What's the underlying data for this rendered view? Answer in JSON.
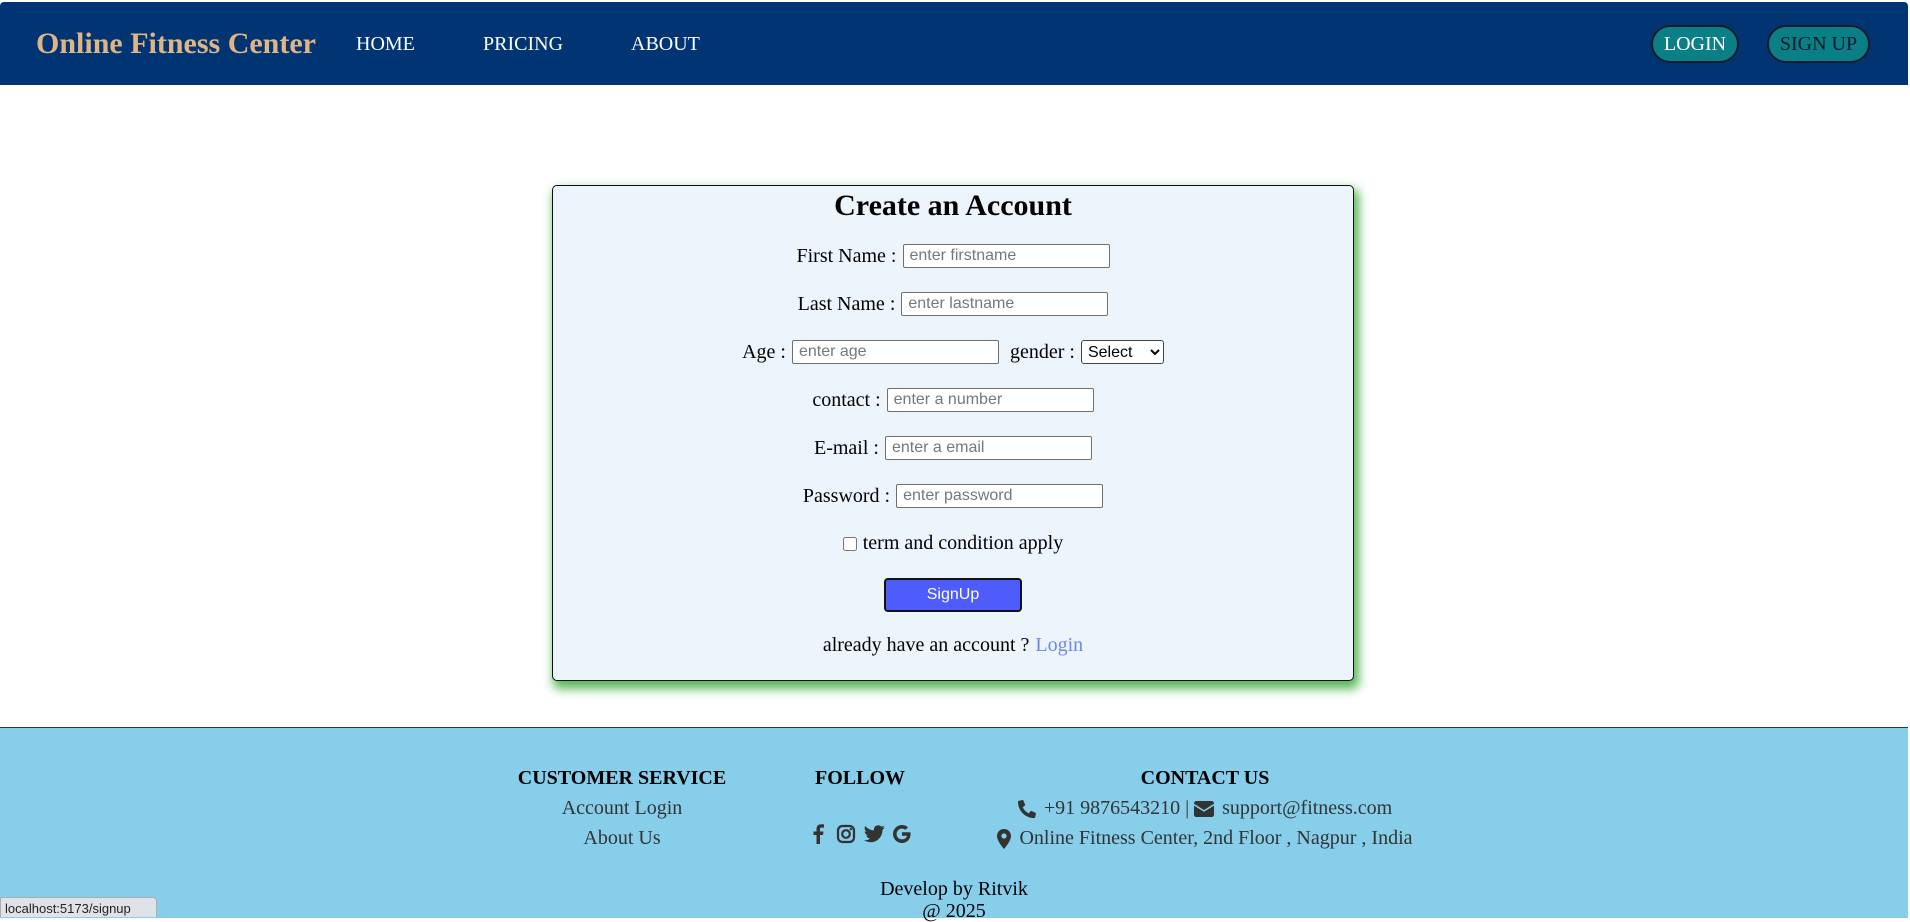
{
  "nav": {
    "brand": "Online Fitness Center",
    "links": [
      "HOME",
      "PRICING",
      "ABOUT"
    ],
    "login_label": "LOGIN",
    "signup_label": "SIGN UP"
  },
  "form": {
    "title": "Create an Account",
    "first_name_label": "First Name :",
    "first_name_placeholder": "enter firstname",
    "last_name_label": "Last Name :",
    "last_name_placeholder": "enter lastname",
    "age_label": "Age :",
    "age_placeholder": "enter age",
    "gender_label": "gender :",
    "gender_selected": "Select",
    "contact_label": "contact :",
    "contact_placeholder": "enter a number",
    "email_label": "E-mail :",
    "email_placeholder": "enter a email",
    "password_label": "Password :",
    "password_placeholder": "enter password",
    "terms_label": "term and condition apply",
    "terms_checked": false,
    "submit_label": "SignUp",
    "already_text": "already have an account ?",
    "login_link": "Login"
  },
  "footer": {
    "customer_service": {
      "heading": "CUSTOMER SERVICE",
      "items": [
        "Account Login",
        "About Us"
      ]
    },
    "follow": {
      "heading": "FOLLOW",
      "icons": [
        "facebook-icon",
        "instagram-icon",
        "twitter-icon",
        "google-icon"
      ]
    },
    "contact": {
      "heading": "CONTACT US",
      "phone": "+91 9876543210 |",
      "email": "support@fitness.com",
      "address": "Online Fitness Center, 2nd Floor , Nagpur , India"
    },
    "developer": "Develop by Ritvik",
    "year": "@ 2025"
  },
  "status_url": "localhost:5173/signup",
  "colors": {
    "nav_bg": "#003473",
    "brand": "#e0b583",
    "nav_button": "#0a7f86",
    "card_bg": "#ecf4fc",
    "card_shadow": "#3caa3c",
    "submit": "#4d5cfb",
    "link": "#6f86f0",
    "footer_bg": "#87ceeb"
  }
}
